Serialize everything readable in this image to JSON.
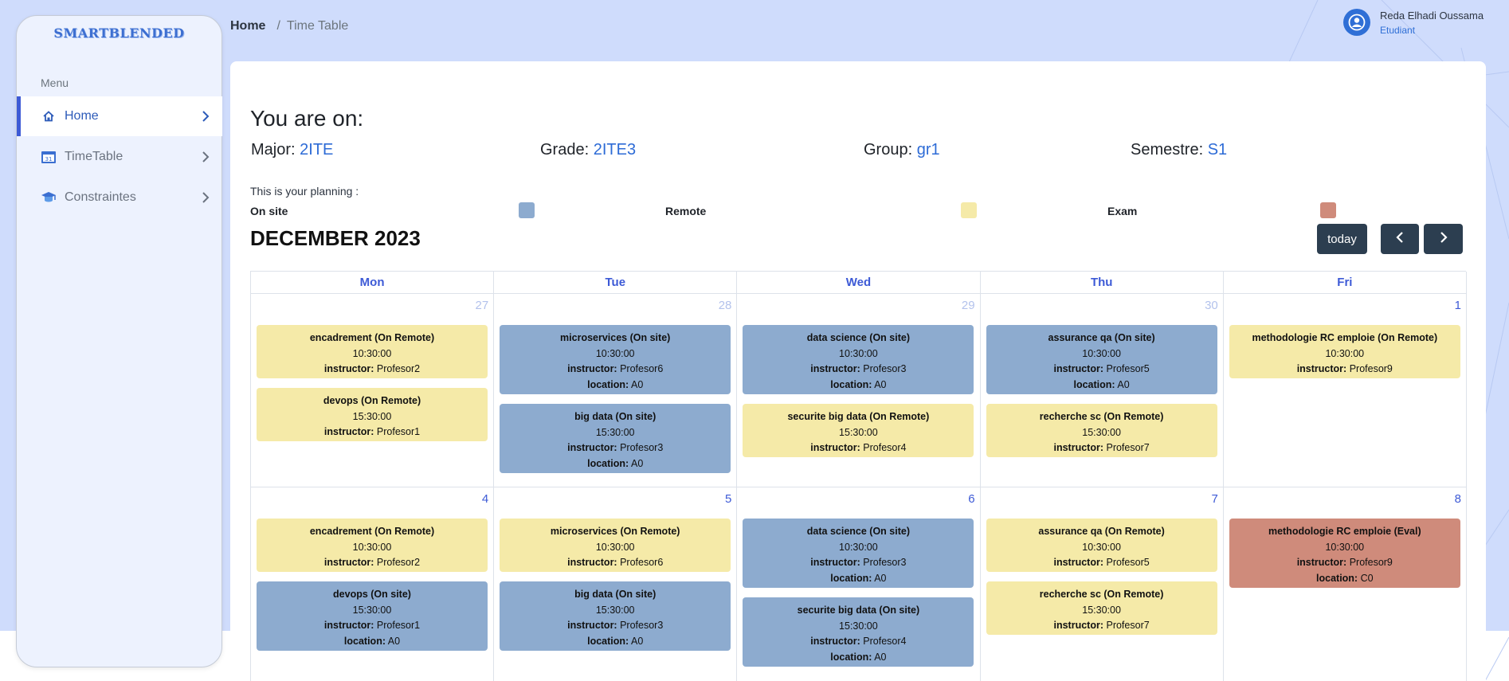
{
  "app": {
    "logo": "SMARTBLENDED"
  },
  "sidebar": {
    "menu_label": "Menu",
    "items": [
      {
        "label": "Home",
        "icon": "home-icon",
        "active": true
      },
      {
        "label": "TimeTable",
        "icon": "calendar-icon",
        "active": false
      },
      {
        "label": "Constraintes",
        "icon": "graduation-cap-icon",
        "active": false
      }
    ]
  },
  "header": {
    "breadcrumb": {
      "home": "Home",
      "separator": "/",
      "current": "Time Table"
    },
    "user": {
      "name": "Reda Elhadi Oussama",
      "role": "Etudiant"
    }
  },
  "main": {
    "heading": "You are on:",
    "info": [
      {
        "label": "Major:",
        "value": "2ITE"
      },
      {
        "label": "Grade:",
        "value": "2ITE3"
      },
      {
        "label": "Group:",
        "value": "gr1"
      },
      {
        "label": "Semestre:",
        "value": "S1"
      }
    ],
    "planning_label": "This is your planning :",
    "legend": [
      {
        "label": "On site",
        "color": "#8dabcf"
      },
      {
        "label": "Remote",
        "color": "#f5eaa8"
      },
      {
        "label": "Exam",
        "color": "#cf8b7b"
      }
    ],
    "calendar": {
      "month_title": "DECEMBER 2023",
      "today_label": "today",
      "prev_icon": "chevron-left-icon",
      "next_icon": "chevron-right-icon",
      "days": [
        "Mon",
        "Tue",
        "Wed",
        "Thu",
        "Fri"
      ],
      "instructor_label": "instructor:",
      "location_label": "location:",
      "weeks": [
        {
          "cells": [
            {
              "day": "27",
              "other_month": true,
              "events": [
                {
                  "title": "encadrement (On Remote)",
                  "time": "10:30:00",
                  "instructor": "Profesor2",
                  "type": "remote"
                },
                {
                  "title": "devops (On Remote)",
                  "time": "15:30:00",
                  "instructor": "Profesor1",
                  "type": "remote"
                }
              ]
            },
            {
              "day": "28",
              "other_month": true,
              "events": [
                {
                  "title": "microservices (On site)",
                  "time": "10:30:00",
                  "instructor": "Profesor6",
                  "location": "A0",
                  "type": "onsite"
                },
                {
                  "title": "big data (On site)",
                  "time": "15:30:00",
                  "instructor": "Profesor3",
                  "location": "A0",
                  "type": "onsite"
                }
              ]
            },
            {
              "day": "29",
              "other_month": true,
              "events": [
                {
                  "title": "data science (On site)",
                  "time": "10:30:00",
                  "instructor": "Profesor3",
                  "location": "A0",
                  "type": "onsite"
                },
                {
                  "title": "securite big data (On Remote)",
                  "time": "15:30:00",
                  "instructor": "Profesor4",
                  "type": "remote"
                }
              ]
            },
            {
              "day": "30",
              "other_month": true,
              "events": [
                {
                  "title": "assurance qa (On site)",
                  "time": "10:30:00",
                  "instructor": "Profesor5",
                  "location": "A0",
                  "type": "onsite"
                },
                {
                  "title": "recherche sc (On Remote)",
                  "time": "15:30:00",
                  "instructor": "Profesor7",
                  "type": "remote"
                }
              ]
            },
            {
              "day": "1",
              "other_month": false,
              "events": [
                {
                  "title": "methodologie RC emploie (On Remote)",
                  "time": "10:30:00",
                  "instructor": "Profesor9",
                  "type": "remote"
                }
              ]
            }
          ]
        },
        {
          "cells": [
            {
              "day": "4",
              "other_month": false,
              "events": [
                {
                  "title": "encadrement (On Remote)",
                  "time": "10:30:00",
                  "instructor": "Profesor2",
                  "type": "remote"
                },
                {
                  "title": "devops (On site)",
                  "time": "15:30:00",
                  "instructor": "Profesor1",
                  "location": "A0",
                  "type": "onsite"
                }
              ]
            },
            {
              "day": "5",
              "other_month": false,
              "events": [
                {
                  "title": "microservices (On Remote)",
                  "time": "10:30:00",
                  "instructor": "Profesor6",
                  "type": "remote"
                },
                {
                  "title": "big data (On site)",
                  "time": "15:30:00",
                  "instructor": "Profesor3",
                  "location": "A0",
                  "type": "onsite"
                }
              ]
            },
            {
              "day": "6",
              "other_month": false,
              "events": [
                {
                  "title": "data science (On site)",
                  "time": "10:30:00",
                  "instructor": "Profesor3",
                  "location": "A0",
                  "type": "onsite"
                },
                {
                  "title": "securite big data (On site)",
                  "time": "15:30:00",
                  "instructor": "Profesor4",
                  "location": "A0",
                  "type": "onsite"
                }
              ]
            },
            {
              "day": "7",
              "other_month": false,
              "events": [
                {
                  "title": "assurance qa (On Remote)",
                  "time": "10:30:00",
                  "instructor": "Profesor5",
                  "type": "remote"
                },
                {
                  "title": "recherche sc (On Remote)",
                  "time": "15:30:00",
                  "instructor": "Profesor7",
                  "type": "remote"
                }
              ]
            },
            {
              "day": "8",
              "other_month": false,
              "events": [
                {
                  "title": "methodologie RC emploie (Eval)",
                  "time": "10:30:00",
                  "instructor": "Profesor9",
                  "location": "C0",
                  "type": "exam"
                }
              ]
            }
          ]
        }
      ]
    }
  }
}
